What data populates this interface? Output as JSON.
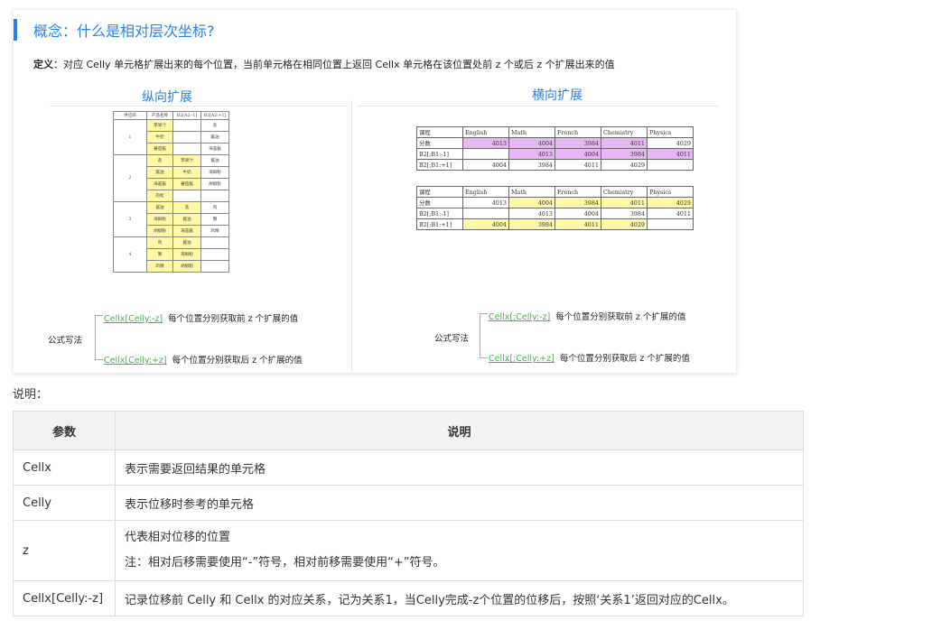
{
  "card": {
    "title": "概念：什么是相对层次坐标?",
    "definition_label": "定义",
    "definition_text": "：对应 Celly 单元格扩展出来的每个位置，当前单元格在相同位置上返回 Cellx 单元格在该位置处前 z 个或后 z 个扩展出来的值",
    "left_title": "纵向扩展",
    "right_title": "横向扩展",
    "vertical_table": {
      "header": [
        "供应商",
        "产品名称",
        "B2[A2:-1]",
        "B2[A2:+1]"
      ],
      "groups": [
        {
          "id": "1",
          "rows": [
            [
              "苹果汁",
              "",
              "盐"
            ],
            [
              "牛奶",
              "",
              "酱油"
            ],
            [
              "蕃茄酱",
              "",
              "海苔酱"
            ]
          ]
        },
        {
          "id": "2",
          "rows": [
            [
              "盐",
              "苹果汁",
              "酱油"
            ],
            [
              "酱油",
              "牛奶",
              "海鲜粉"
            ],
            [
              "海苔酱",
              "蕃茄酱",
              "胡椒粉"
            ],
            [
              "肉松",
              "",
              ""
            ]
          ]
        },
        {
          "id": "3",
          "rows": [
            [
              "酱油",
              "盐",
              "鸡"
            ],
            [
              "海鲜粉",
              "酱油",
              "蟹"
            ],
            [
              "胡椒粉",
              "海苔酱",
              "鸡精"
            ]
          ]
        },
        {
          "id": "4",
          "rows": [
            [
              "鸡",
              "酱油",
              ""
            ],
            [
              "蟹",
              "海鲜粉",
              ""
            ],
            [
              "鸡精",
              "胡椒粉",
              ""
            ]
          ]
        }
      ]
    },
    "horizontal_tables": [
      {
        "header": [
          "课程",
          "English",
          "Math",
          "French",
          "Chemistry",
          "Physics"
        ],
        "rows": [
          [
            "分数",
            "4013",
            "4004",
            "3984",
            "4011",
            "4029"
          ],
          [
            "B2[;B1:-1]",
            "",
            "4013",
            "4004",
            "3984",
            "4011"
          ],
          [
            "B2[;B1:+1]",
            "4004",
            "3984",
            "4011",
            "4029",
            ""
          ]
        ]
      },
      {
        "header": [
          "课程",
          "English",
          "Math",
          "French",
          "Chemistry",
          "Physics"
        ],
        "rows": [
          [
            "分数",
            "4013",
            "4004",
            "3984",
            "4011",
            "4029"
          ],
          [
            "B2[;B1:-1]",
            "",
            "4013",
            "4004",
            "3984",
            "4011"
          ],
          [
            "B2[;B1:+1]",
            "4004",
            "3984",
            "4011",
            "4029",
            ""
          ]
        ]
      }
    ],
    "left_formula": {
      "label": "公式写法",
      "f1_code": "Cellx[Celly:-z]",
      "f1_desc": "每个位置分别获取前 z 个扩展的值",
      "f2_code": "Cellx[Celly:+z]",
      "f2_desc": "每个位置分别获取后 z 个扩展的值"
    },
    "right_formula": {
      "label": "公式写法",
      "f1_code": "Cellx[;Celly:-z]",
      "f1_desc": "每个位置分别获取前 z 个扩展的值",
      "f2_code": "Cellx[;Celly:+z]",
      "f2_desc": "每个位置分别获取后 z 个扩展的值"
    }
  },
  "note_label": "说明：",
  "params": {
    "headers": [
      "参数",
      "说明"
    ],
    "rows": [
      {
        "key": "Cellx",
        "desc": "表示需要返回结果的单元格"
      },
      {
        "key": "Celly",
        "desc": "表示位移时参考的单元格"
      },
      {
        "key": "z",
        "desc": "代表相对位移的位置",
        "desc2": "注：相对后移需要使用“-”符号，相对前移需要使用“+”符号。"
      },
      {
        "key": "Cellx[Celly:-z]",
        "desc": "记录位移前 Celly 和 Cellx 的对应关系，记为关系1，当Celly完成-z个位置的位移后，按照‘关系1’返回对应的Cellx。"
      }
    ]
  },
  "colors": {
    "accent": "#2680eb",
    "highlight_yellow": "#fff8a6",
    "highlight_purple": "#e9b6f5",
    "formula_green": "#4caf50"
  }
}
